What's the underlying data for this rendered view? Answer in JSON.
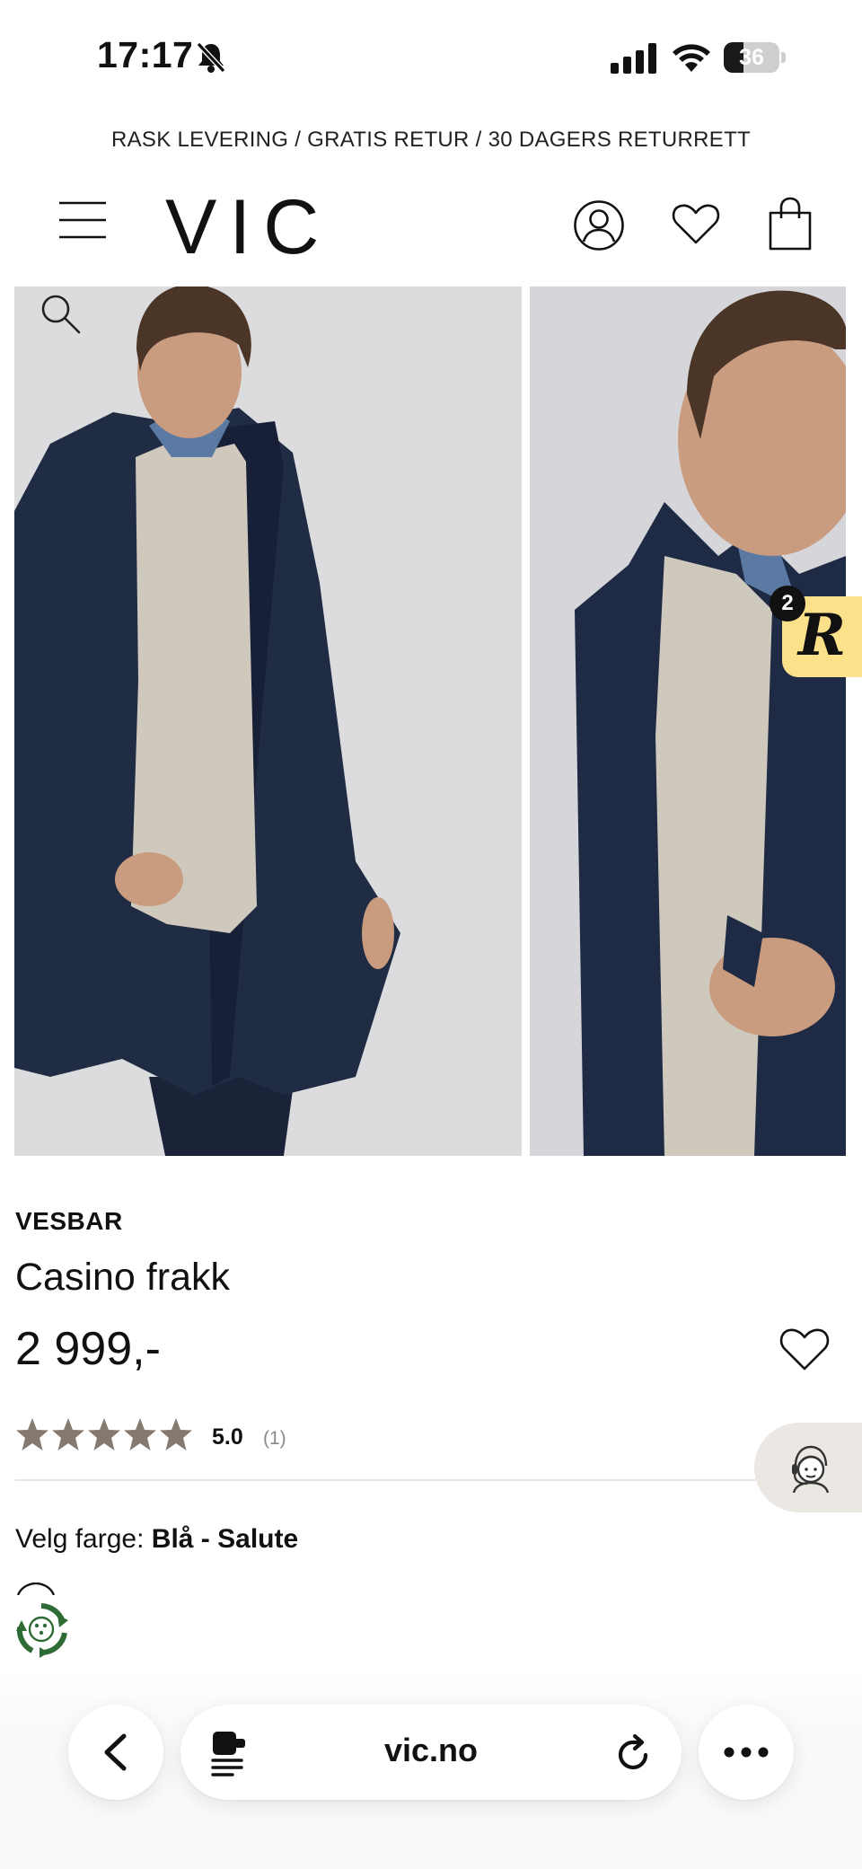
{
  "status_bar": {
    "time": "17:17",
    "battery_level": "36",
    "battery_fraction": 0.36,
    "icons": [
      "bell-slash-icon",
      "cellular-signal-icon",
      "wifi-icon",
      "battery-icon"
    ]
  },
  "announcement": "RASK LEVERING / GRATIS RETUR / 30 DAGERS RETURRETT",
  "header": {
    "logo": "VIC",
    "icons": [
      "menu-icon",
      "account-icon",
      "wishlist-icon",
      "shopping-bag-icon"
    ]
  },
  "gallery": {
    "images": [
      "product-photo-full-body",
      "product-photo-closeup"
    ],
    "zoom_icon": "search-icon"
  },
  "widget": {
    "letter": "R",
    "badge_count": "2"
  },
  "product": {
    "brand": "VESBAR",
    "name": "Casino frakk",
    "price": "2 999,-",
    "rating": {
      "value": "5.0",
      "count": "(1)",
      "stars": 5,
      "star_color": "#857a6f"
    },
    "color_label": "Velg farge:",
    "color_value": "Blå - Salute"
  },
  "browser": {
    "url": "vic.no",
    "icons": [
      "back-arrow-icon",
      "reader-icon",
      "reload-icon",
      "more-icon"
    ]
  },
  "colors": {
    "text": "#111111",
    "announcement": "#222222",
    "widget_bg": "#fde08a",
    "support_bg": "#ebe7e2",
    "recycle_green": "#2e6b35"
  }
}
